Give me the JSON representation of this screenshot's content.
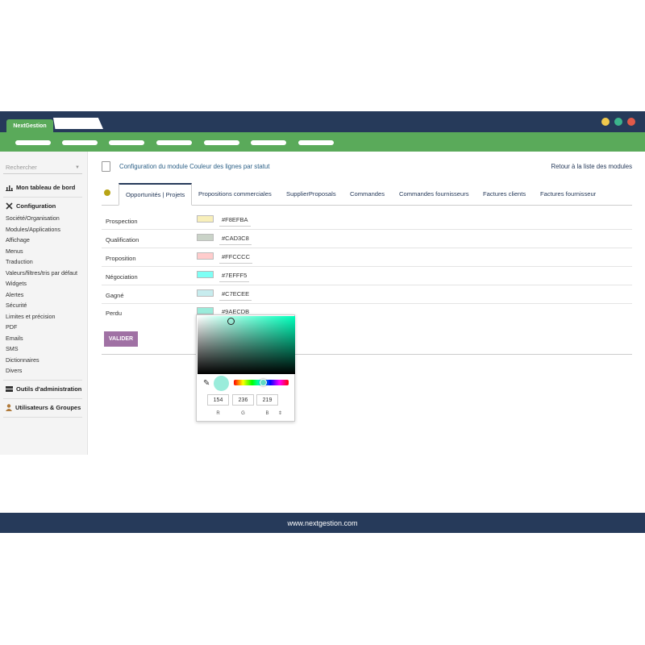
{
  "browser": {
    "tab_label": "NextGestion",
    "dots": [
      "#f0c94d",
      "#3cb48c",
      "#e05a4a"
    ]
  },
  "sidebar": {
    "search_placeholder": "Rechercher",
    "dashboard": "Mon tableau de bord",
    "configuration": "Configuration",
    "items": [
      "Société/Organisation",
      "Modules/Applications",
      "Affichage",
      "Menus",
      "Traduction",
      "Valeurs/filtres/tris par défaut",
      "Widgets",
      "Alertes",
      "Sécurité",
      "Limites et précision",
      "PDF",
      "Emails",
      "SMS",
      "Dictionnaires",
      "Divers"
    ],
    "admin_tools": "Outils d'administration",
    "users_groups": "Utilisateurs & Groupes"
  },
  "main": {
    "title": "Configuration du module Couleur des lignes par statut",
    "back_link": "Retour à la liste des modules",
    "tabs": [
      "Opportunités | Projets",
      "Propositions commerciales",
      "SupplierProposals",
      "Commandes",
      "Commandes fournisseurs",
      "Factures clients",
      "Factures fournisseur"
    ],
    "rows": [
      {
        "label": "Prospection",
        "hex": "#F8EFBA",
        "color": "#F8EFBA"
      },
      {
        "label": "Qualification",
        "hex": "#CAD3C8",
        "color": "#CAD3C8"
      },
      {
        "label": "Proposition",
        "hex": "#FFCCCC",
        "color": "#FFCCCC"
      },
      {
        "label": "Négociation",
        "hex": "#7EFFF5",
        "color": "#7EFFF5"
      },
      {
        "label": "Gagné",
        "hex": "#C7ECEE",
        "color": "#C7ECEE"
      },
      {
        "label": "Perdu",
        "hex": "#9AECDB",
        "color": "#9AECDB"
      }
    ],
    "submit_label": "VALIDER"
  },
  "picker": {
    "r": "154",
    "g": "236",
    "b": "219",
    "r_label": "R",
    "g_label": "G",
    "b_label": "B",
    "preview_color": "#9AECDB"
  },
  "footer": {
    "url": "www.nextgestion.com"
  }
}
